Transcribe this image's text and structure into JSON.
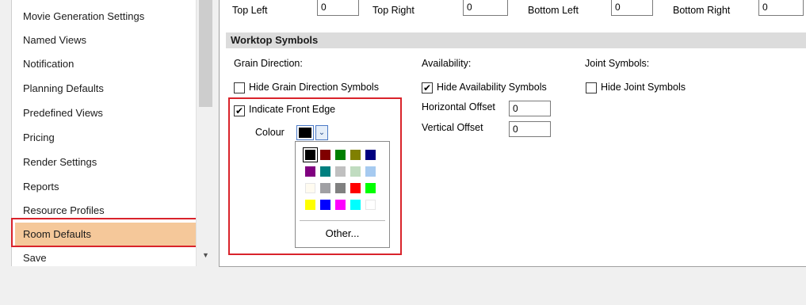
{
  "nav": {
    "items": [
      {
        "label": "Movie Generation Settings",
        "selected": false
      },
      {
        "label": "Named Views",
        "selected": false
      },
      {
        "label": "Notification",
        "selected": false
      },
      {
        "label": "Planning Defaults",
        "selected": false
      },
      {
        "label": "Predefined Views",
        "selected": false
      },
      {
        "label": "Pricing",
        "selected": false
      },
      {
        "label": "Render Settings",
        "selected": false
      },
      {
        "label": "Reports",
        "selected": false
      },
      {
        "label": "Resource Profiles",
        "selected": false
      },
      {
        "label": "Room Defaults",
        "selected": true
      },
      {
        "label": "Save",
        "selected": false
      }
    ],
    "scroll_down_icon": "▼"
  },
  "corners": {
    "top_left_label": "Top Left",
    "top_left_value": "0",
    "top_right_label": "Top Right",
    "top_right_value": "0",
    "bottom_left_label": "Bottom Left",
    "bottom_left_value": "0",
    "bottom_right_label": "Bottom Right",
    "bottom_right_value": "0"
  },
  "worktop": {
    "section_title": "Worktop Symbols",
    "grain_heading": "Grain Direction:",
    "hide_grain_label": "Hide Grain Direction Symbols",
    "hide_grain_checked": false,
    "front_edge_label": "Indicate Front Edge",
    "front_edge_checked": true,
    "colour_label": "Colour",
    "colour_value": "#000000",
    "availability_heading": "Availability:",
    "hide_availability_label": "Hide Availability Symbols",
    "hide_availability_checked": true,
    "horizontal_offset_label": "Horizontal Offset",
    "horizontal_offset_value": "0",
    "vertical_offset_label": "Vertical Offset",
    "vertical_offset_value": "0",
    "joint_heading": "Joint Symbols:",
    "hide_joint_label": "Hide Joint Symbols",
    "hide_joint_checked": false
  },
  "colour_popup": {
    "swatches": [
      [
        "#000000",
        "#800000",
        "#008000",
        "#808000",
        "#000080"
      ],
      [
        "#800080",
        "#008080",
        "#c0c0c0",
        "#c0dcc0",
        "#a6caf0"
      ],
      [
        "#fffbf0",
        "#a0a0a4",
        "#808080",
        "#ff0000",
        "#00ff00"
      ],
      [
        "#ffff00",
        "#0000ff",
        "#ff00ff",
        "#00ffff",
        "#ffffff"
      ]
    ],
    "selected_swatch": "#000000",
    "other_label": "Other..."
  },
  "check_mark": "✔",
  "dropdown_icon": "⌄"
}
